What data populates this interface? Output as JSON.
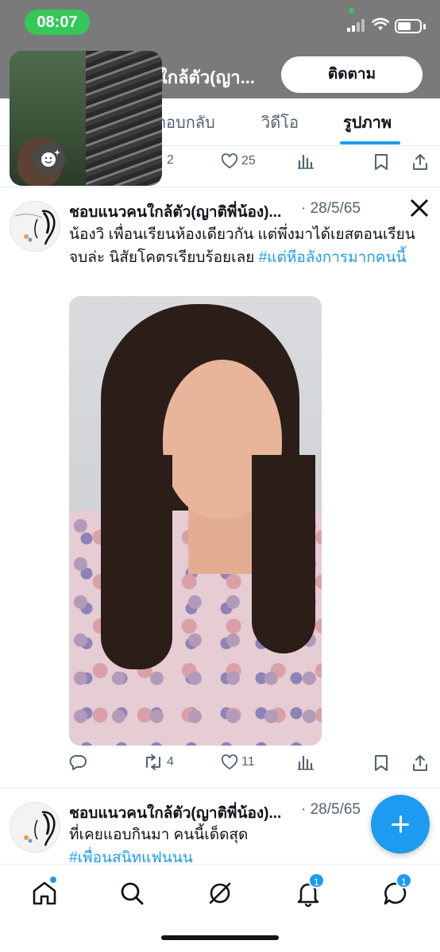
{
  "status_bar": {
    "time": "08:07"
  },
  "header": {
    "title": "ใกล้ตัว(ญา...",
    "follow_label": "ติดตาม"
  },
  "tabs": [
    {
      "label": "ตอบกลับ",
      "active": false
    },
    {
      "label": "วิดีโอ",
      "active": false
    },
    {
      "label": "รูปภาพ",
      "active": true
    }
  ],
  "prev_tweet_actions": {
    "retweets": "2",
    "likes": "25"
  },
  "tweets": [
    {
      "author": "ชอบแนวคนใกล้ตัว(ญาติพี่น้อง)...",
      "date": "· 28/5/65",
      "text": "น้องวิ เพื่อนเรียนห้องเดียวกัน แต่พึ่งมาได้เยสตอนเรียนจบล่ะ นิสัยโคตรเรียบร้อยเลย",
      "hashtag": "#แต่หีอลังการมากคนนี้",
      "retweets": "4",
      "likes": "11"
    },
    {
      "author": "ชอบแนวคนใกล้ตัว(ญาติพี่น้อง)...",
      "date": "· 28/5/65",
      "text": "ที่เคยแอบกินมา คนนี้เด็ดสุด",
      "hashtag": "#เพื่อนสนิทแฟนนน"
    }
  ],
  "bottom_nav": {
    "notifications_badge": "1",
    "messages_badge": "1"
  },
  "colors": {
    "accent": "#1d9bf0",
    "status_green": "#34c759"
  }
}
